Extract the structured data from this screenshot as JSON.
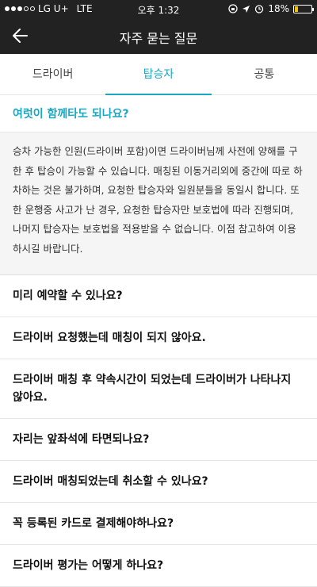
{
  "status_bar": {
    "carrier": "LG U+",
    "network": "LTE",
    "time": "오후 1:32",
    "battery": "18%",
    "battery_level": 0.18,
    "battery_color": "#f2c200"
  },
  "header": {
    "title": "자주 묻는 질문",
    "back_icon": "arrow-left-icon"
  },
  "tabs": [
    {
      "label": "드라이버",
      "active": false
    },
    {
      "label": "탑승자",
      "active": true
    },
    {
      "label": "공통",
      "active": false
    }
  ],
  "accent_color": "#1aa7c1",
  "faq": {
    "open_question": "여럿이 함께타도 되나요?",
    "answer": "승차 가능한 인원(드라이버 포함)이면 드라이버님께 사전에 양해를 구한 후 탑승이 가능할 수 있습니다. 매칭된 이동거리외에 중간에 따로 하차하는 것은 불가하며, 요청한 탑승자와 일원분들을 동일시 합니다. 또한 운행중 사고가 난 경우, 요청한 탑승자만 보호법에 따라 진행되며, 나머지 탑승자는 보호법을 적용받을 수 없습니다. 이점 참고하여 이용하시길 바랍니다.",
    "items": [
      "미리 예약할 수 있나요?",
      "드라이버 요청했는데 매칭이 되지 않아요.",
      "드라이버 매칭 후 약속시간이 되었는데 드라이버가 나타나지 않아요.",
      "자리는 앞좌석에 타면되나요?",
      "드라이버 매칭되었는데 취소할 수 있나요?",
      "꼭 등록된 카드로 결제해야하나요?",
      "드라이버 평가는 어떻게 하나요?"
    ]
  }
}
